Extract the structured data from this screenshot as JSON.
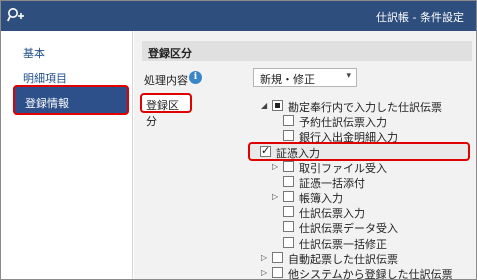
{
  "window": {
    "title": "仕訳帳 - 条件設定"
  },
  "sidebar": {
    "items": [
      {
        "label": "基本"
      },
      {
        "label": "明細項目"
      },
      {
        "label": "登録情報"
      }
    ]
  },
  "section": {
    "header": "登録区分"
  },
  "processing": {
    "label": "処理内容",
    "value": "新規・修正"
  },
  "registration": {
    "label": "登録区分"
  },
  "tree": {
    "nodes": [
      {
        "label": "勘定奉行内で入力した仕訳伝票"
      },
      {
        "label": "予約仕訳伝票入力"
      },
      {
        "label": "銀行入出金明細入力"
      },
      {
        "label": "証憑入力"
      },
      {
        "label": "取引ファイル受入"
      },
      {
        "label": "証憑一括添付"
      },
      {
        "label": "帳簿入力"
      },
      {
        "label": "仕訳伝票入力"
      },
      {
        "label": "仕訳伝票データ受入"
      },
      {
        "label": "仕訳伝票一括修正"
      },
      {
        "label": "自動起票した仕訳伝票"
      },
      {
        "label": "他システムから登録した仕訳伝票"
      }
    ]
  },
  "colors": {
    "titlebar": "#2e4e7e",
    "active_item": "#2d4f8a",
    "highlight_border": "#e00000",
    "link_text": "#1f4e8c",
    "info_icon": "#3a86c8"
  }
}
